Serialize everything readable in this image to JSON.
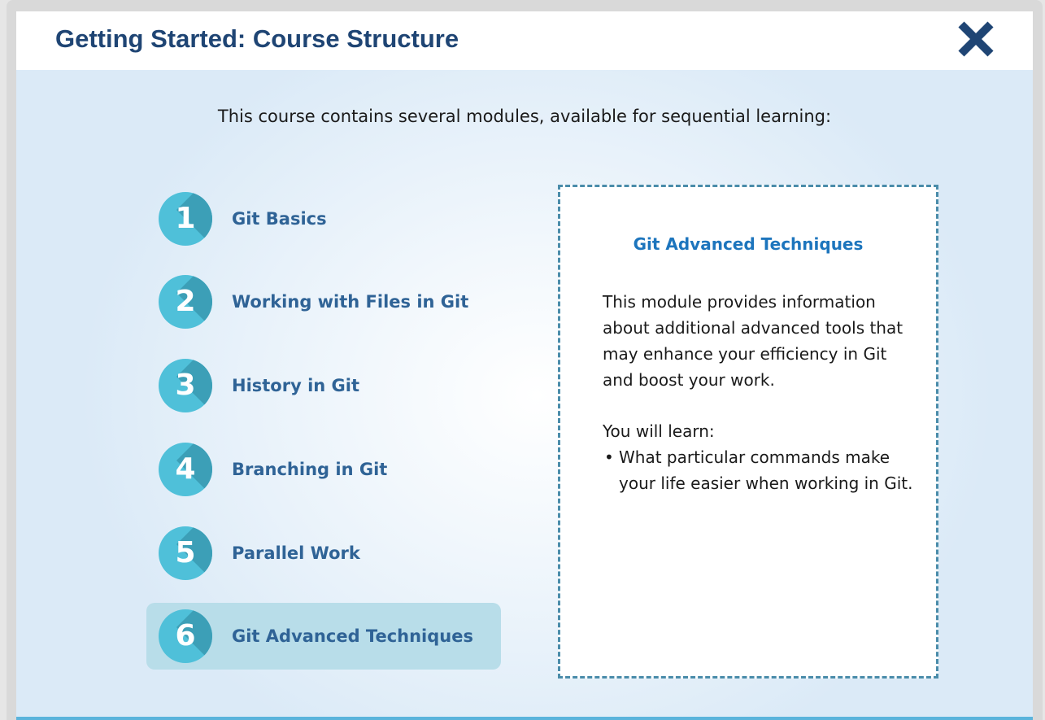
{
  "header": {
    "title": "Getting Started: Course Structure",
    "close_icon": "close-x-icon"
  },
  "intro": "This course contains several modules, available for sequential learning:",
  "modules": [
    {
      "number": "1",
      "label": "Git Basics"
    },
    {
      "number": "2",
      "label": "Working with Files in Git"
    },
    {
      "number": "3",
      "label": "History in Git"
    },
    {
      "number": "4",
      "label": "Branching in Git"
    },
    {
      "number": "5",
      "label": "Parallel Work"
    },
    {
      "number": "6",
      "label": "Git Advanced Techniques"
    }
  ],
  "active_module": "6",
  "detail": {
    "title": "Git Advanced Techniques",
    "description": "This module provides information about additional advanced tools that may enhance your efficiency in Git and boost your work.",
    "learn_heading": "You will learn:",
    "bullet_symbol": "•",
    "bullets": [
      "What particular commands make your life easier when working in Git."
    ]
  },
  "colors": {
    "title": "#1f4574",
    "badge": "#4fc0d9",
    "badge_shade": "#3c9fb7",
    "module_label": "#2f6396",
    "active_highlight": "#b8dde9",
    "detail_title": "#1d75bd",
    "dashed_border": "#4a8caa",
    "bottom_line": "#5ab4dc"
  }
}
